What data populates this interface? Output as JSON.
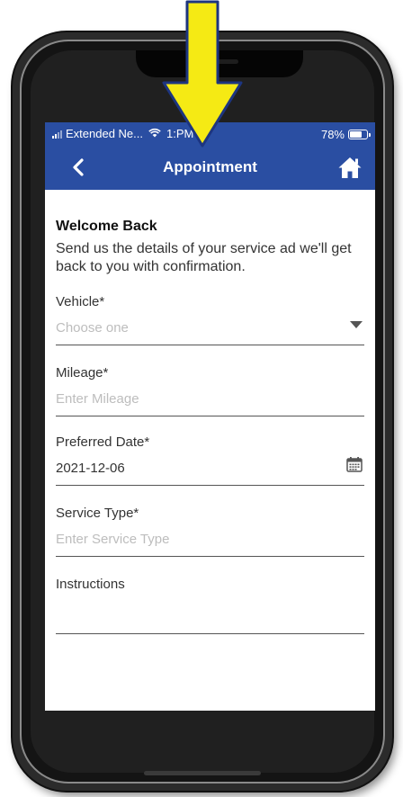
{
  "status_bar": {
    "carrier": "Extended Ne...",
    "time": "1:PM",
    "battery": "78%"
  },
  "navbar": {
    "title": "Appointment"
  },
  "form": {
    "welcome": "Welcome Back",
    "intro": "Send us the details of your service ad we'll get back to you with confirmation.",
    "vehicle": {
      "label": "Vehicle*",
      "placeholder": "Choose one"
    },
    "mileage": {
      "label": "Mileage*",
      "placeholder": "Enter Mileage"
    },
    "preferred_date": {
      "label": "Preferred Date*",
      "value": "2021-12-06"
    },
    "service_type": {
      "label": "Service Type*",
      "placeholder": "Enter Service Type"
    },
    "instructions": {
      "label": "Instructions",
      "value": ""
    }
  },
  "colors": {
    "header_blue": "#2a4ea2",
    "arrow_yellow": "#f5ea14",
    "arrow_outline": "#1d3580"
  },
  "icons": [
    "back-chevron-icon",
    "home-icon",
    "calendar-icon",
    "dropdown-caret-icon",
    "wifi-icon",
    "signal-icon",
    "battery-icon",
    "down-arrow-annotation-icon"
  ]
}
